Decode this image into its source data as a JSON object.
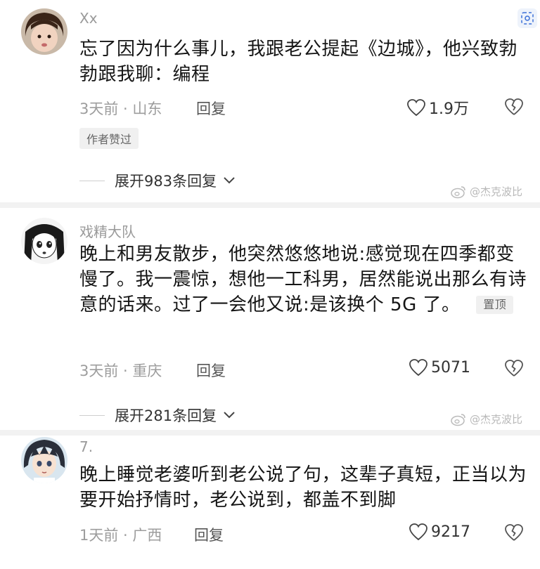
{
  "comments": [
    {
      "username": "Xx",
      "text": "忘了因为什么事儿，我跟老公提起《边城》，他兴致勃勃跟我聊：编程",
      "time_location": "3天前 · 山东",
      "reply_label": "回复",
      "likes": "1.9万",
      "author_badge": "作者赞过",
      "expand_label": "展开983条回复"
    },
    {
      "username": "戏精大队",
      "text": "晚上和男友散步，他突然悠悠地说:感觉现在四季都变慢了。我一震惊，想他一工科男，居然能说出那么有诗意的话来。过了一会他又说:是该换个 5G 了。",
      "pinned_badge": "置顶",
      "time_location": "3天前 · 重庆",
      "reply_label": "回复",
      "likes": "5071",
      "expand_label": "展开281条回复"
    },
    {
      "username": "7.",
      "text": "晚上睡觉老婆听到老公说了句，这辈子真短，正当以为要开始抒情时，老公说到，都盖不到脚",
      "time_location": "1天前 · 广西",
      "reply_label": "回复",
      "likes": "9217"
    }
  ],
  "watermark": "@杰克波比",
  "colors": {
    "text": "#151515",
    "meta": "#9d9d9d",
    "separator": "#f2f2f2"
  }
}
